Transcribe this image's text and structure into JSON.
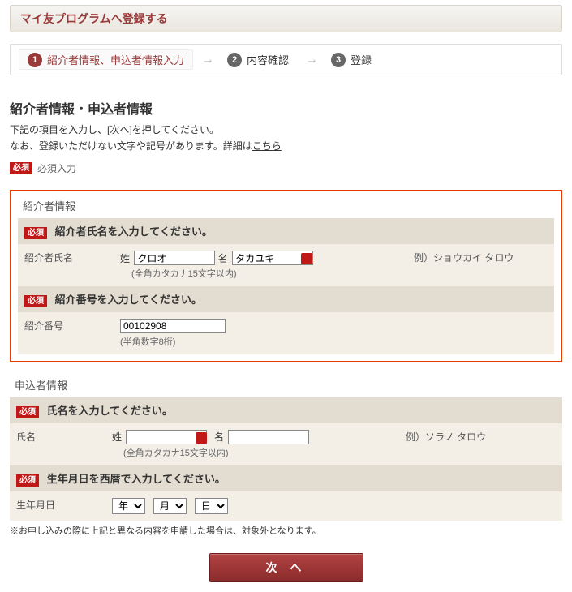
{
  "header": {
    "title": "マイ友プログラムへ登録する"
  },
  "stepper": {
    "steps": [
      {
        "num": "1",
        "label": "紹介者情報、申込者情報入力",
        "current": true
      },
      {
        "num": "2",
        "label": "内容確認",
        "current": false
      },
      {
        "num": "3",
        "label": "登録",
        "current": false
      }
    ]
  },
  "intro": {
    "title": "紹介者情報・申込者情報",
    "line1": "下記の項目を入力し、[次へ]を押してください。",
    "line2_prefix": "なお、登録いただけない文字や記号があります。詳細は",
    "line2_link": "こちら"
  },
  "legend": {
    "text": "必須入力"
  },
  "referrer": {
    "group_title": "紹介者情報",
    "name_section": {
      "header": "紹介者氏名を入力してください。",
      "row_label": "紹介者氏名",
      "sei_label": "姓",
      "mei_label": "名",
      "sei_value": "クロオ",
      "mei_value": "タカユキ",
      "hint": "(全角カタカナ15文字以内)",
      "example": "例）ショウカイ タロウ"
    },
    "number_section": {
      "header": "紹介番号を入力してください。",
      "row_label": "紹介番号",
      "value": "00102908",
      "hint": "(半角数字8桁)"
    }
  },
  "applicant": {
    "group_title": "申込者情報",
    "name_section": {
      "header": "氏名を入力してください。",
      "row_label": "氏名",
      "sei_label": "姓",
      "mei_label": "名",
      "sei_value": "",
      "mei_value": "",
      "hint": "(全角カタカナ15文字以内)",
      "example": "例）ソラノ タロウ"
    },
    "dob_section": {
      "header": "生年月日を西暦で入力してください。",
      "row_label": "生年月日",
      "year_label": "年",
      "month_label": "月",
      "day_label": "日"
    }
  },
  "note": "※お申し込みの際に上記と異なる内容を申請した場合は、対象外となります。",
  "next_button": "次  へ"
}
